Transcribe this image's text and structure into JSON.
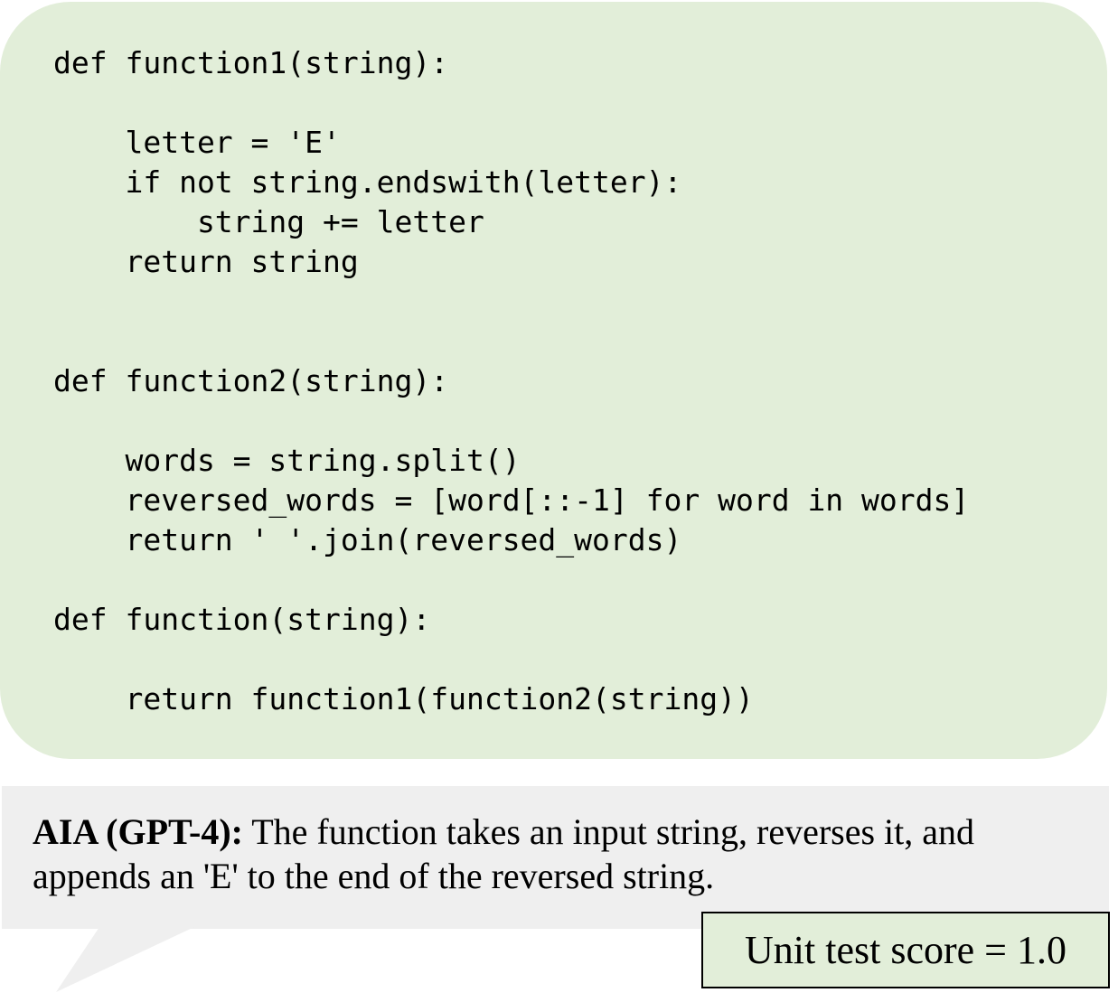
{
  "colors": {
    "code_panel_bg": "#e2eed9",
    "bubble_bg": "#efefef",
    "score_box_bg": "#e2eed9"
  },
  "code": {
    "lines": [
      "def function1(string):",
      "    letter = 'E'",
      "    if not string.endswith(letter):",
      "        string += letter",
      "    return string",
      "def function2(string):",
      "    words = string.split()",
      "    reversed_words = [word[::-1] for word in words]",
      "    return ' '.join(reversed_words)",
      "def function(string):",
      "    return function1(function2(string))"
    ]
  },
  "explanation": {
    "speaker": "AIA (GPT-4):",
    "text": " The function takes an input string, reverses it, and appends an 'E' to the end of the reversed string."
  },
  "score": {
    "label": "Unit test score = 1.0"
  }
}
